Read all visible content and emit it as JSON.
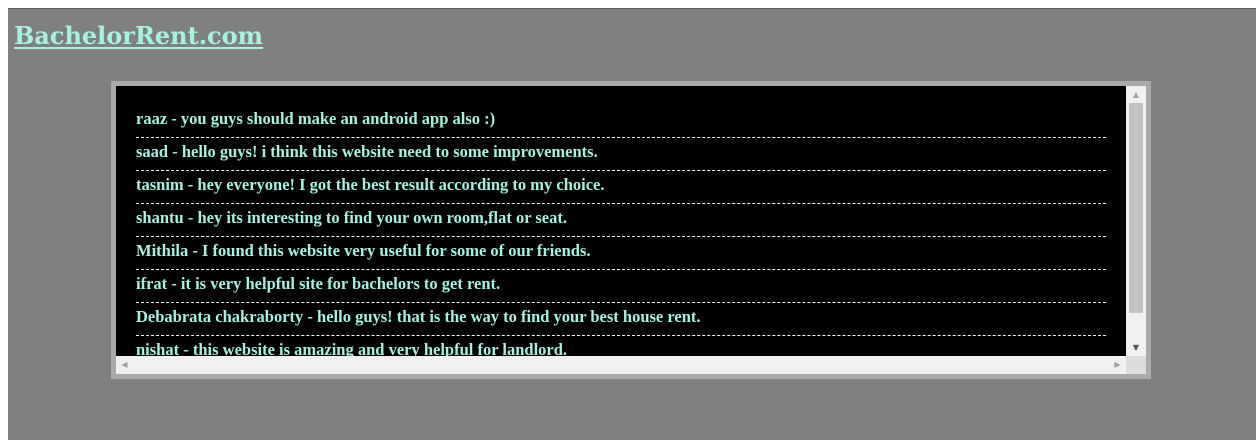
{
  "site": {
    "title": "BachelorRent.com"
  },
  "comments": [
    "raaz - you guys should make an android app also :)",
    "saad - hello guys! i think this website need to some improvements.",
    "tasnim - hey everyone! I got the best result according to my choice.",
    "shantu - hey its interesting to find your own room,flat or seat.",
    "Mithila - I found this website very useful for some of our friends.",
    "ifrat - it is very helpful site for bachelors to get rent.",
    "Debabrata chakraborty - hello guys! that is the way to find your best house rent.",
    "nishat - this website is amazing and very helpful for landlord."
  ],
  "icons": {
    "scroll_up": "chevron-up-icon",
    "scroll_down": "chevron-down-icon",
    "scroll_left": "chevron-left-icon",
    "scroll_right": "chevron-right-icon"
  },
  "colors": {
    "page_background": "#808080",
    "panel_border": "#aaaaaa",
    "list_background": "#000000",
    "accent_text": "#a6f1df"
  }
}
